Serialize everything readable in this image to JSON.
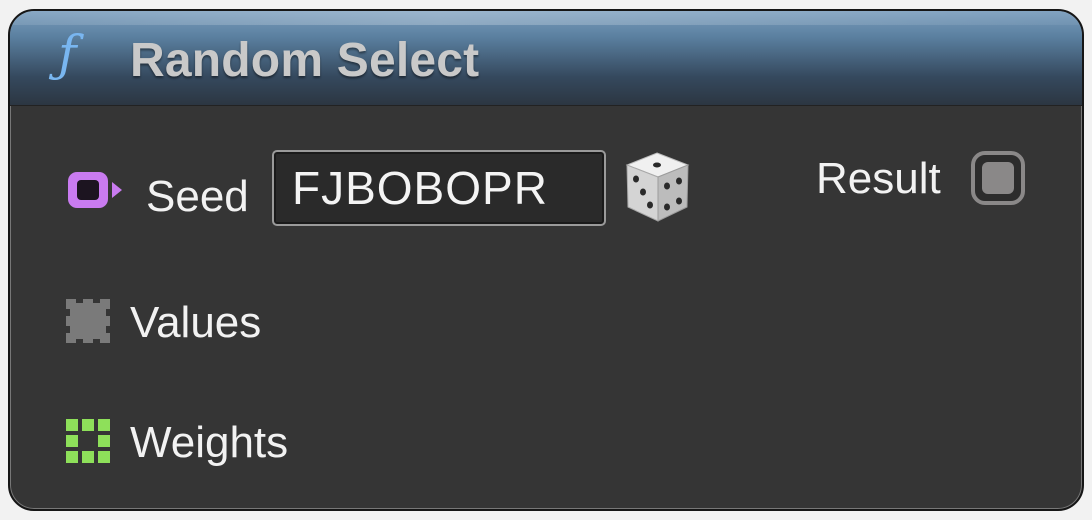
{
  "node": {
    "title": "Random Select",
    "icon": "function-icon",
    "header_color": "#5a7f9f"
  },
  "inputs": {
    "seed": {
      "label": "Seed",
      "value": "FJBOBOPR",
      "pin_color": "#c97bf0",
      "randomize_icon": "dice-icon"
    },
    "values": {
      "label": "Values",
      "pin_color": "#7a7a7a"
    },
    "weights": {
      "label": "Weights",
      "pin_color": "#8ee05a"
    }
  },
  "outputs": {
    "result": {
      "label": "Result",
      "pin_color": "#8a8888"
    }
  }
}
